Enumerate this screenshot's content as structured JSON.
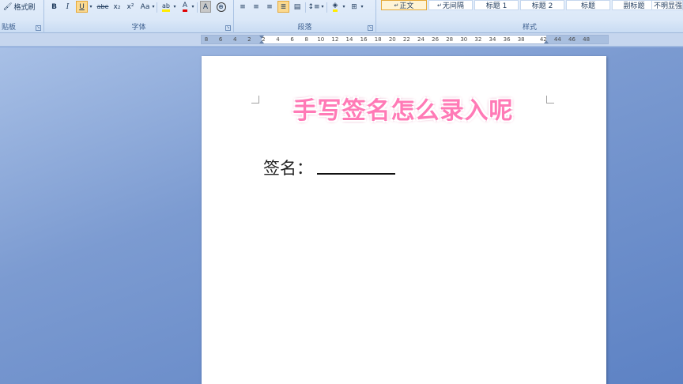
{
  "ribbon": {
    "clipboard": {
      "format_painter_label": "格式刷",
      "group_label": "贴板"
    },
    "font": {
      "group_label": "字体",
      "bold": "B",
      "italic": "I",
      "underline": "U",
      "strikethrough": "abe",
      "subscript": "x₂",
      "superscript": "x²",
      "change_case": "Aa",
      "highlight": "ab",
      "font_color": "A",
      "char_shading": "A",
      "enclose": "字"
    },
    "paragraph": {
      "group_label": "段落"
    },
    "styles": {
      "group_label": "样式",
      "items": [
        "正文",
        "无间隔",
        "标题 1",
        "标题 2",
        "标题",
        "副标题",
        "不明显强"
      ]
    }
  },
  "ruler": {
    "ticks": [
      "8",
      "6",
      "4",
      "2",
      "2",
      "4",
      "6",
      "8",
      "10",
      "12",
      "14",
      "16",
      "18",
      "20",
      "22",
      "24",
      "26",
      "28",
      "30",
      "32",
      "34",
      "36",
      "38",
      "42",
      "44",
      "46",
      "48"
    ]
  },
  "document": {
    "title": "手写签名怎么录入呢",
    "signature_label": "签名："
  },
  "colors": {
    "title_pink": "#ff7ab6",
    "active_style": "#e5a93a",
    "workspace_blue": "#6f8fd0"
  }
}
